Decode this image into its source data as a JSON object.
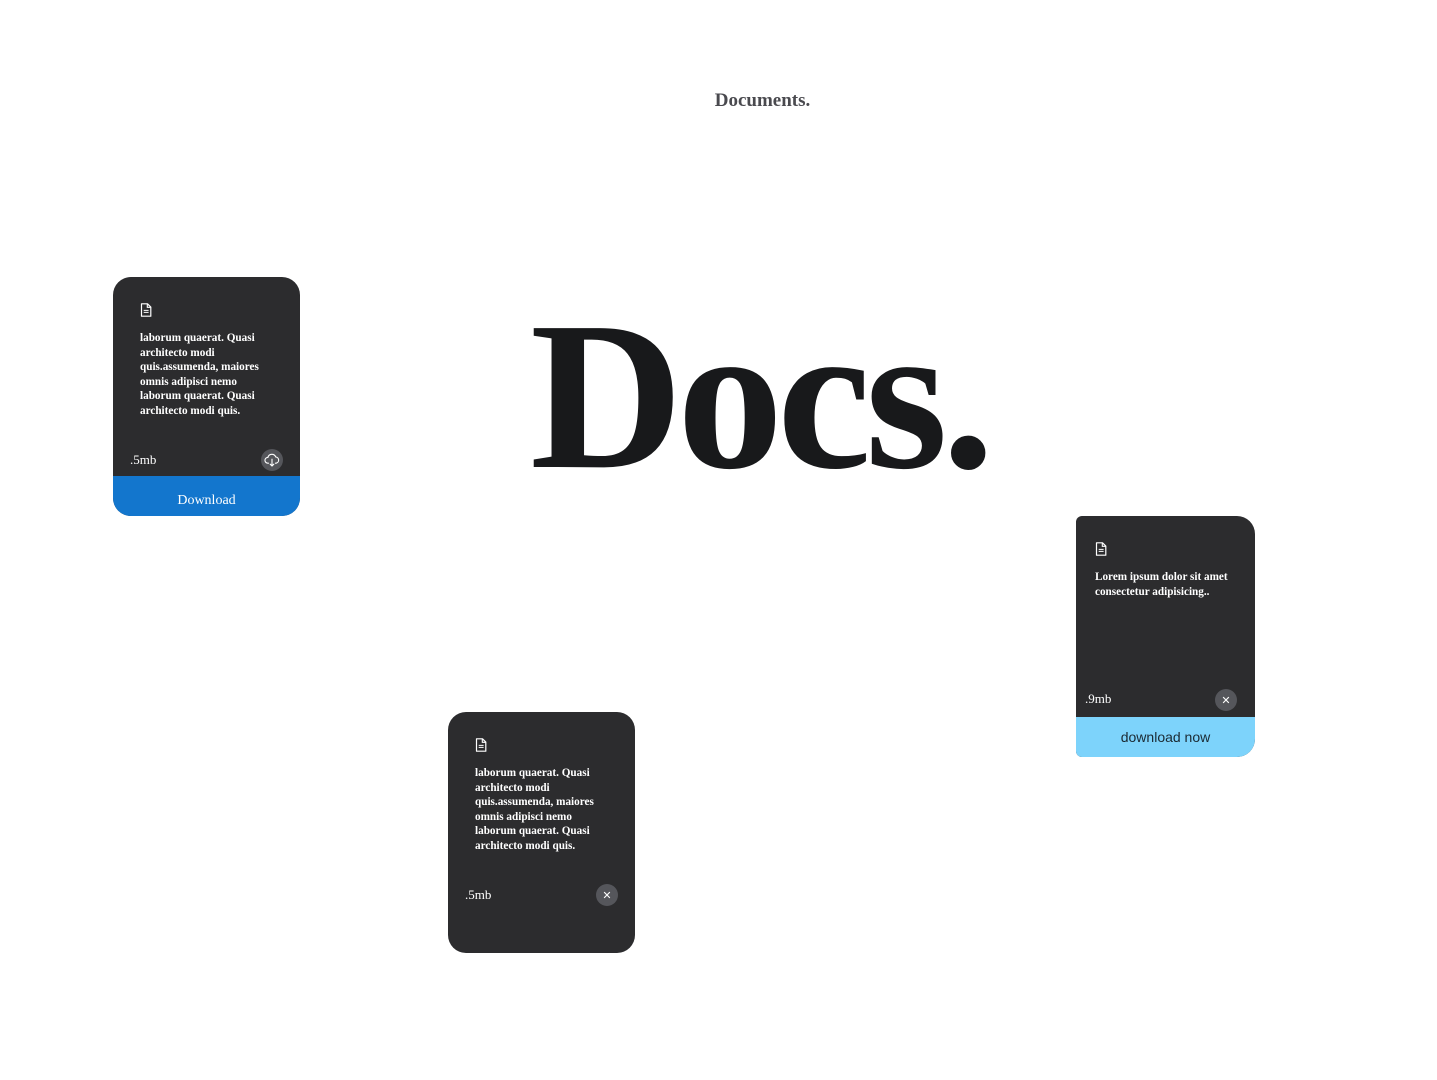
{
  "header": {
    "subtitle": "Documents.",
    "title": "Docs."
  },
  "cards": [
    {
      "icon": "document-icon",
      "text": "laborum quaerat. Quasi architecto modi quis.assumenda, maiores omnis adipisci nemo laborum quaerat. Quasi architecto modi quis.",
      "size": ".5mb",
      "action_icon": "cloud-download-icon",
      "button_label": "Download",
      "button_color": "#1376cd"
    },
    {
      "icon": "document-icon",
      "text": "laborum quaerat. Quasi architecto modi quis.assumenda, maiores omnis adipisci nemo laborum quaerat. Quasi architecto modi quis.",
      "size": ".5mb",
      "action_icon": "close-icon",
      "close_glyph": "✕"
    },
    {
      "icon": "document-icon",
      "text": "Lorem ipsum dolor sit amet consectetur adipisicing..",
      "size": ".9mb",
      "action_icon": "close-icon",
      "close_glyph": "✕",
      "button_label": "download now",
      "button_color": "#7dd3fb"
    }
  ],
  "colors": {
    "card_background": "#2c2c2e",
    "title": "#18191b",
    "subtitle": "#4a4a4f"
  }
}
